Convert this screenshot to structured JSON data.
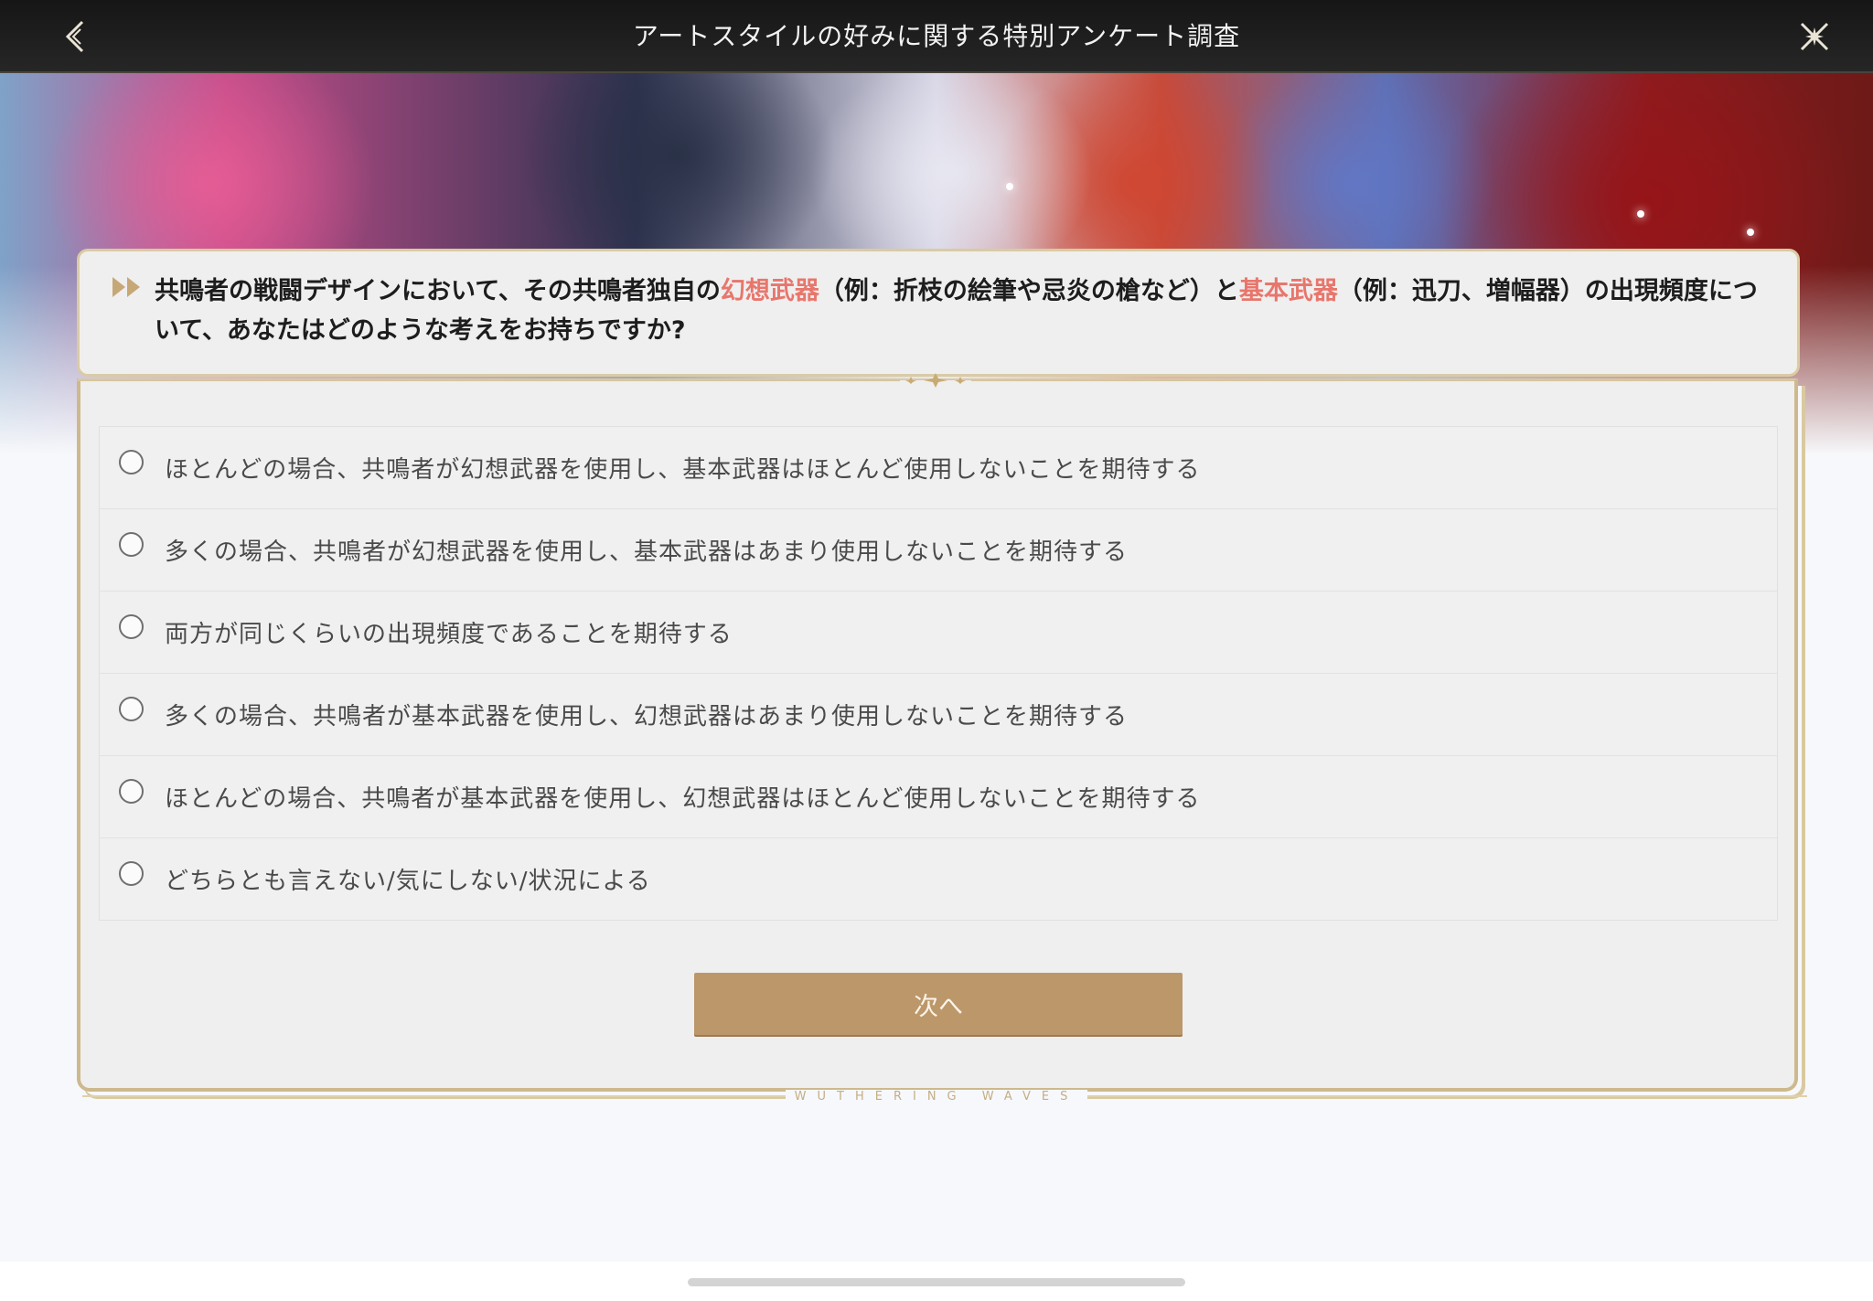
{
  "header": {
    "title": "アートスタイルの好みに関する特別アンケート調査",
    "back_icon": "chevron-left-icon",
    "close_icon": "close-sparkle-icon"
  },
  "question": {
    "part1": "共鳴者の戦闘デザインにおいて、その共鳴者独自の",
    "highlight1": "幻想武器",
    "part2": "（例：折枝の絵筆や忌炎の槍など）と",
    "highlight2": "基本武器",
    "part3": "（例：迅刀、増幅器）の出現頻度について、あなたはどのような考えをお持ちですか?",
    "highlight_color": "#e8766c"
  },
  "options": [
    {
      "label": "ほとんどの場合、共鳴者が幻想武器を使用し、基本武器はほとんど使用しないことを期待する",
      "selected": false
    },
    {
      "label": "多くの場合、共鳴者が幻想武器を使用し、基本武器はあまり使用しないことを期待する",
      "selected": false
    },
    {
      "label": "両方が同じくらいの出現頻度であることを期待する",
      "selected": false
    },
    {
      "label": "多くの場合、共鳴者が基本武器を使用し、幻想武器はあまり使用しないことを期待する",
      "selected": false
    },
    {
      "label": "ほとんどの場合、共鳴者が基本武器を使用し、幻想武器はほとんど使用しないことを期待する",
      "selected": false
    },
    {
      "label": "どちらとも言えない/気にしない/状況による",
      "selected": false
    }
  ],
  "next_button": {
    "label": "次へ",
    "color": "#bc976a"
  },
  "footer": {
    "brand": "WUTHERING WAVES"
  },
  "colors": {
    "header_bg": "#1c1c1c",
    "frame_gold": "#cdb98d"
  }
}
